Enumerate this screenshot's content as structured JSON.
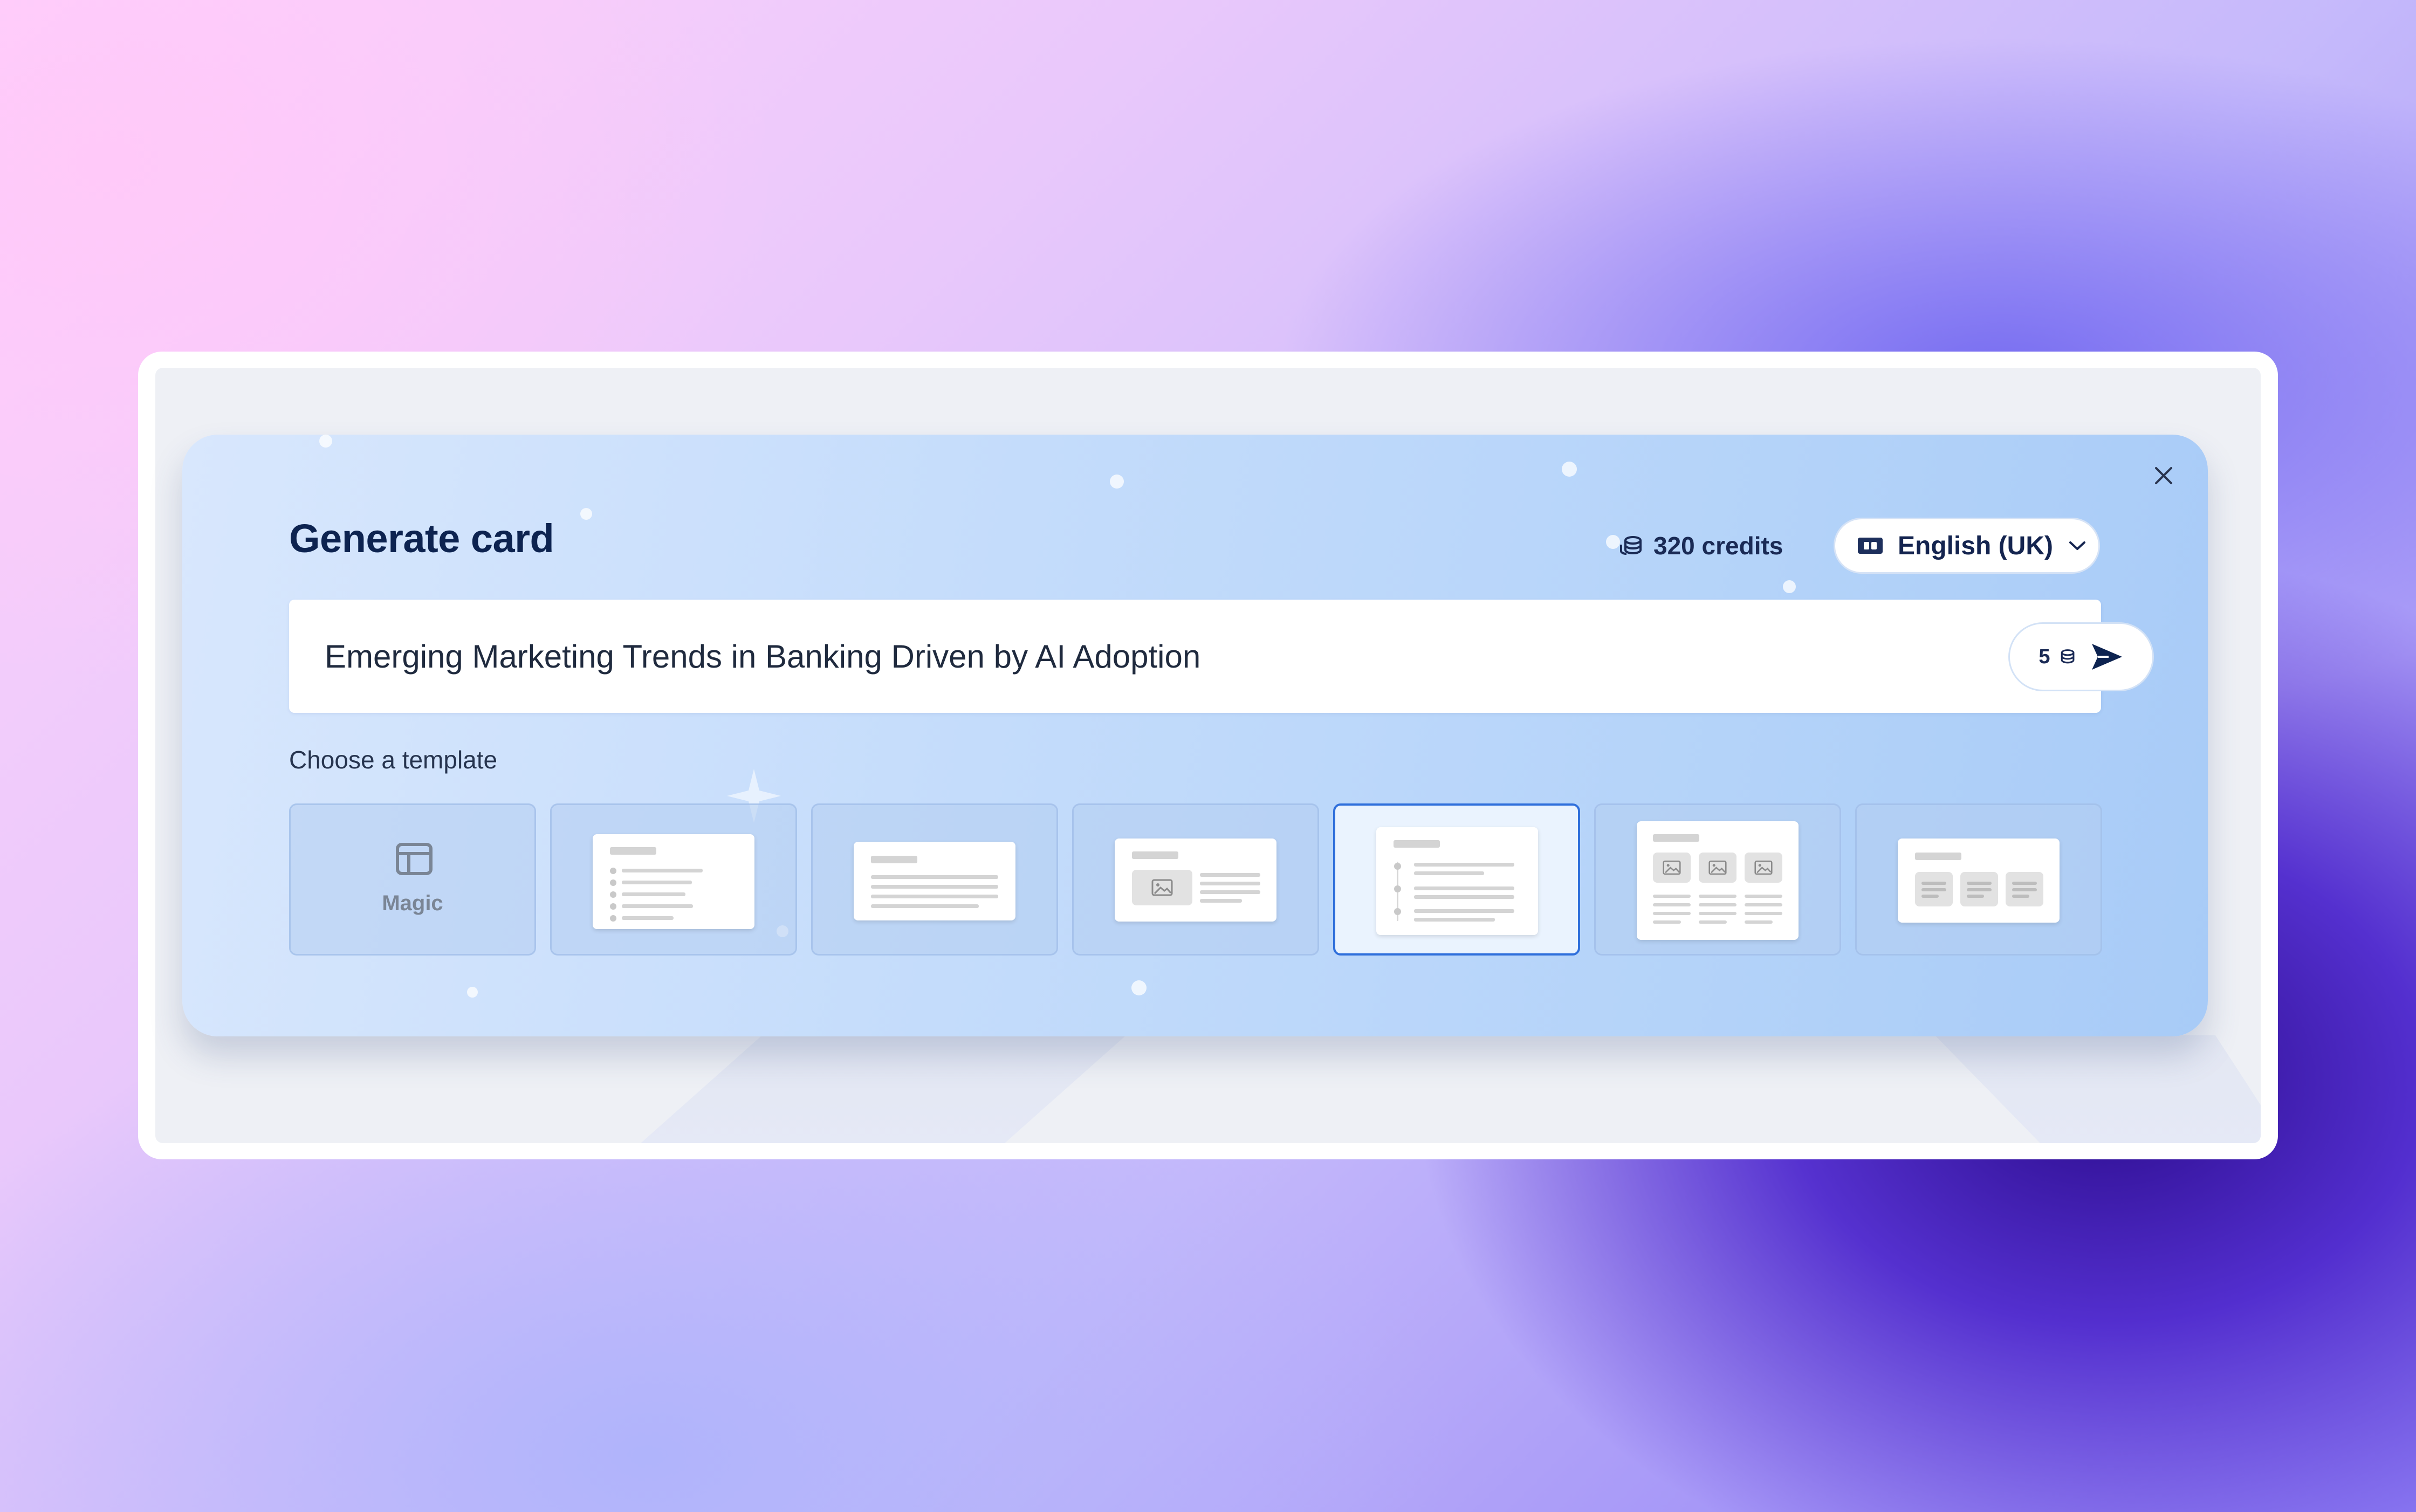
{
  "modal": {
    "title": "Generate card",
    "credits_label": "320 credits",
    "language": "English (UK)"
  },
  "prompt": {
    "value": "Emerging Marketing Trends in Banking Driven by AI Adoption",
    "cost": "5"
  },
  "templates": {
    "heading": "Choose a template",
    "items": [
      {
        "label": "Magic"
      },
      {
        "label": ""
      },
      {
        "label": ""
      },
      {
        "label": ""
      },
      {
        "label": ""
      },
      {
        "label": ""
      },
      {
        "label": ""
      }
    ],
    "selected_index": 4
  },
  "colors": {
    "accent": "#2f6fdb",
    "title": "#0d2350",
    "modal_bg": "#c4dcfb"
  },
  "icons": {
    "close": "close-icon",
    "credits": "coins-icon",
    "language": "language-icon",
    "dropdown": "chevron-down-icon",
    "send": "send-icon",
    "magic": "layout-icon"
  }
}
